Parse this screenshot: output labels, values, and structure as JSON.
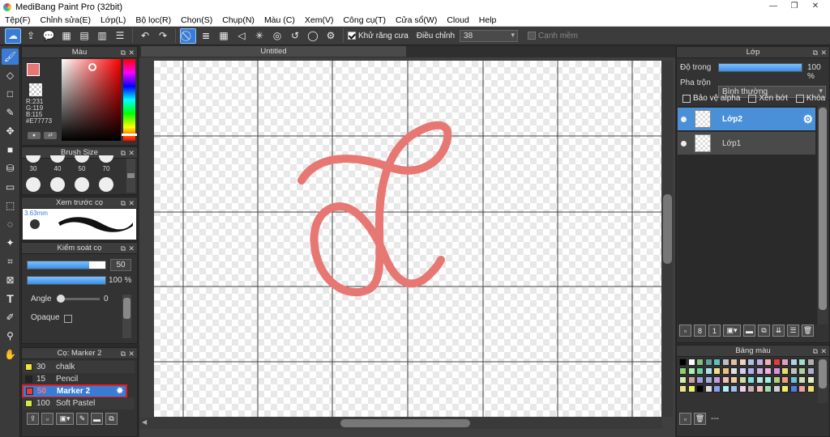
{
  "window": {
    "title": "MediBang Paint Pro (32bit)",
    "minimize": "—",
    "maximize": "❐",
    "close": "✕"
  },
  "menu": [
    "Tệp(F)",
    "Chỉnh sửa(E)",
    "Lớp(L)",
    "Bộ lọc(R)",
    "Chọn(S)",
    "Chụp(N)",
    "Màu (C)",
    "Xem(V)",
    "Công cụ(T)",
    "Cửa sổ(W)",
    "Cloud",
    "Help"
  ],
  "toolbar": {
    "antialias_label": "Khử răng cưa",
    "correction_label": "Điều chỉnh",
    "correction_value": "38",
    "edge_label": "Cạnh mềm",
    "icons": [
      "snap-icon",
      "save-icon",
      "comment-icon",
      "grid-layout-icon",
      "export-icon",
      "panel-icon",
      "menu-icon",
      "undo-icon",
      "redo-icon",
      "no-snap-icon",
      "parallel-icon",
      "grid-icon",
      "vanishing-icon",
      "radial-icon",
      "circle-icon",
      "curve-icon",
      "ellipse-icon",
      "settings-icon"
    ]
  },
  "tools": [
    "brush-icon",
    "eraser-icon",
    "rectangle-icon",
    "pen-icon",
    "move-icon",
    "fill-rect-icon",
    "bucket-icon",
    "gradient-icon",
    "select-rect-icon",
    "lasso-icon",
    "magic-wand-icon",
    "select-pen-icon",
    "select-eraser-icon",
    "text-icon",
    "dropper-icon",
    "eyedropper-icon",
    "hand-icon"
  ],
  "color_panel": {
    "title": "Màu",
    "r": "R:231",
    "g": "G:119",
    "b": "B:115",
    "hex": "#E77773",
    "primary": "#e77773"
  },
  "brush_size": {
    "title": "Brush Size",
    "sizes": [
      "30",
      "40",
      "50",
      "70"
    ]
  },
  "brush_preview": {
    "title": "Xem trước cọ",
    "size": "3.63mm"
  },
  "brush_control": {
    "title": "Kiểm soát cọ",
    "size_value": "50",
    "opacity_value": "100 %",
    "angle_label": "Angle",
    "angle_value": "0",
    "opaque_label": "Opaque",
    "size_fill": 0.79,
    "opacity_fill": 1.0
  },
  "brush_list": {
    "title": "Cọ: Marker 2",
    "items": [
      {
        "size": "30",
        "name": "chalk",
        "color": "#f2e23b",
        "selected": false
      },
      {
        "size": "15",
        "name": "Pencil",
        "color": "#222222",
        "selected": false
      },
      {
        "size": "50",
        "name": "Marker 2",
        "color": "#e63b3b",
        "selected": true
      },
      {
        "size": "100",
        "name": "Soft Pastel",
        "color": "#d4e84a",
        "selected": false
      }
    ]
  },
  "document": {
    "tab": "Untitled",
    "stroke_color": "#e77773"
  },
  "layer_panel": {
    "title": "Lớp",
    "opacity_label": "Độ trong",
    "opacity_value": "100 %",
    "opacity_fill": 1.0,
    "blend_label": "Pha trộn",
    "blend_value": "Bình thường",
    "protect_alpha": "Bảo vệ alpha",
    "clipping": "Xén bớt",
    "lock": "Khóa",
    "layers": [
      {
        "name": "Lớp2",
        "selected": true
      },
      {
        "name": "Lớp1",
        "selected": false
      }
    ]
  },
  "swatch_panel": {
    "title": "Bảng màu",
    "footer_text": "---",
    "colors": [
      "#000000",
      "#ffffff",
      "#7fbf7f",
      "#5f9f9f",
      "#5fbfbf",
      "#bfbfbf",
      "#dfbf9f",
      "#efcfbf",
      "#afbfdf",
      "#bfafdf",
      "#efafaf",
      "#e63b3b",
      "#df9fbf",
      "#afcfef",
      "#9fdfcf",
      "#afafaf",
      "#8fcf6f",
      "#afefaf",
      "#6fcf9f",
      "#afdfef",
      "#efdf8f",
      "#efbf7f",
      "#dfdfdf",
      "#cfcfef",
      "#afafef",
      "#cfafdf",
      "#efafdf",
      "#df8fdf",
      "#dfdf6f",
      "#bfbfbf",
      "#afcf9f",
      "#afafcf",
      "#cfefaf",
      "#cf9f9f",
      "#9f9fdf",
      "#9fafdf",
      "#bf9fdf",
      "#efbfbf",
      "#efcf9f",
      "#cfdf9f",
      "#7fdfdf",
      "#bfe3df",
      "#9fefdf",
      "#afcf7f",
      "#ef9f7f",
      "#6fbfdf",
      "#cfdfaf",
      "#dfefbf",
      "#efe090",
      "#efef6f",
      "#000000",
      "#dfdfdf",
      "#8f9fef",
      "#afefef",
      "#9fbfef",
      "#efcfef",
      "#cfafaf",
      "#efbfbf",
      "#9fdfaf",
      "#cfcfcf",
      "#efef6f",
      "#4f7fdf",
      "#ef9f9f",
      "#efdf6f"
    ]
  }
}
